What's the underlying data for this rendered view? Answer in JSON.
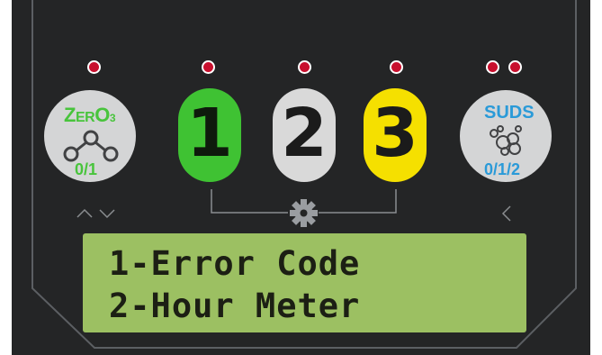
{
  "ozone_button": {
    "title_z": "Z",
    "title_rest": "ER",
    "title_o": "O",
    "title_sub": "3",
    "mode": "0/1",
    "icon": "ozone-molecule-icon"
  },
  "program_buttons": [
    {
      "label": "1",
      "color": "#3fc233",
      "text_color": "#0e1a0c"
    },
    {
      "label": "2",
      "color": "#d9d9d9",
      "text_color": "#1b1b1b"
    },
    {
      "label": "3",
      "color": "#f5e000",
      "text_color": "#1b1b1b"
    }
  ],
  "suds_button": {
    "title": "SUDS",
    "mode": "0/1/2",
    "icon": "suds-bubbles-icon"
  },
  "settings_icon": "gear-icon",
  "nav_icons": [
    "chevron-up-icon",
    "chevron-down-icon",
    "chevron-left-icon"
  ],
  "lcd": {
    "line1": "1-Error Code",
    "line2": "2-Hour Meter",
    "background": "#9cc062"
  },
  "colors": {
    "panel": "#242526",
    "led": "#c8102e",
    "ozone_accent": "#48c43c",
    "suds_accent": "#2a9ad8"
  }
}
